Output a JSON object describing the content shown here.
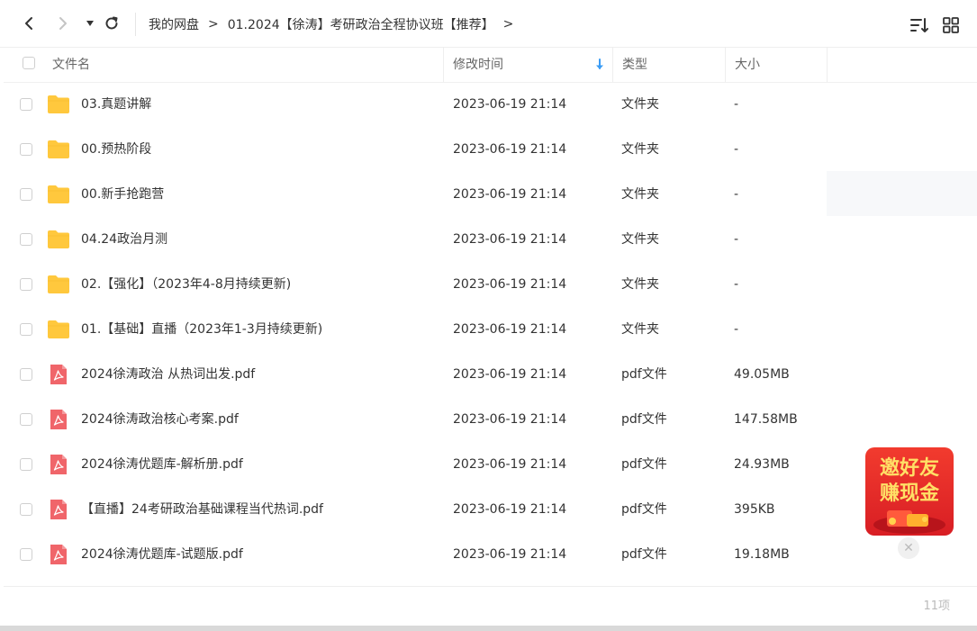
{
  "toolbar": {
    "back_icon": "chevron-left-icon",
    "forward_icon": "chevron-right-icon",
    "dropdown_icon": "caret-down-icon",
    "refresh_icon": "refresh-icon",
    "sort_icon": "sort-list-icon",
    "grid_icon": "grid-view-icon"
  },
  "breadcrumb": {
    "items": [
      "我的网盘",
      "01.2024【徐涛】考研政治全程协议班【推荐】"
    ],
    "separator": ">"
  },
  "table": {
    "headers": {
      "name": "文件名",
      "modified": "修改时间",
      "type": "类型",
      "size": "大小"
    },
    "sort_indicator": "arrow-down-icon",
    "rows": [
      {
        "name": "03.真题讲解",
        "modified": "2023-06-19 21:14",
        "type": "文件夹",
        "size": "-",
        "icon": "folder-icon"
      },
      {
        "name": "00.预热阶段",
        "modified": "2023-06-19 21:14",
        "type": "文件夹",
        "size": "-",
        "icon": "folder-icon"
      },
      {
        "name": "00.新手抢跑营",
        "modified": "2023-06-19 21:14",
        "type": "文件夹",
        "size": "-",
        "icon": "folder-icon"
      },
      {
        "name": "04.24政治月测",
        "modified": "2023-06-19 21:14",
        "type": "文件夹",
        "size": "-",
        "icon": "folder-icon"
      },
      {
        "name": "02.【强化】（2023年4-8月持续更新)",
        "modified": "2023-06-19 21:14",
        "type": "文件夹",
        "size": "-",
        "icon": "folder-icon"
      },
      {
        "name": "01.【基础】直播（2023年1-3月持续更新)",
        "modified": "2023-06-19 21:14",
        "type": "文件夹",
        "size": "-",
        "icon": "folder-icon"
      },
      {
        "name": "2024徐涛政治 从热词出发.pdf",
        "modified": "2023-06-19 21:14",
        "type": "pdf文件",
        "size": "49.05MB",
        "icon": "pdf-icon"
      },
      {
        "name": "2024徐涛政治核心考案.pdf",
        "modified": "2023-06-19 21:14",
        "type": "pdf文件",
        "size": "147.58MB",
        "icon": "pdf-icon"
      },
      {
        "name": "2024徐涛优题库-解析册.pdf",
        "modified": "2023-06-19 21:14",
        "type": "pdf文件",
        "size": "24.93MB",
        "icon": "pdf-icon"
      },
      {
        "name": "【直播】24考研政治基础课程当代热词.pdf",
        "modified": "2023-06-19 21:14",
        "type": "pdf文件",
        "size": "395KB",
        "icon": "pdf-icon"
      },
      {
        "name": "2024徐涛优题库-试题版.pdf",
        "modified": "2023-06-19 21:14",
        "type": "pdf文件",
        "size": "19.18MB",
        "icon": "pdf-icon"
      }
    ]
  },
  "footer": {
    "item_count": "11项"
  },
  "promo": {
    "line1": "邀好友",
    "line2": "赚现金",
    "close_icon": "close-icon"
  },
  "colors": {
    "folder": "#FFC83D",
    "pdf": "#F0656A",
    "sort_arrow": "#3B9CF5",
    "promo_bg": "#E8272B",
    "promo_text": "#FFE066"
  }
}
